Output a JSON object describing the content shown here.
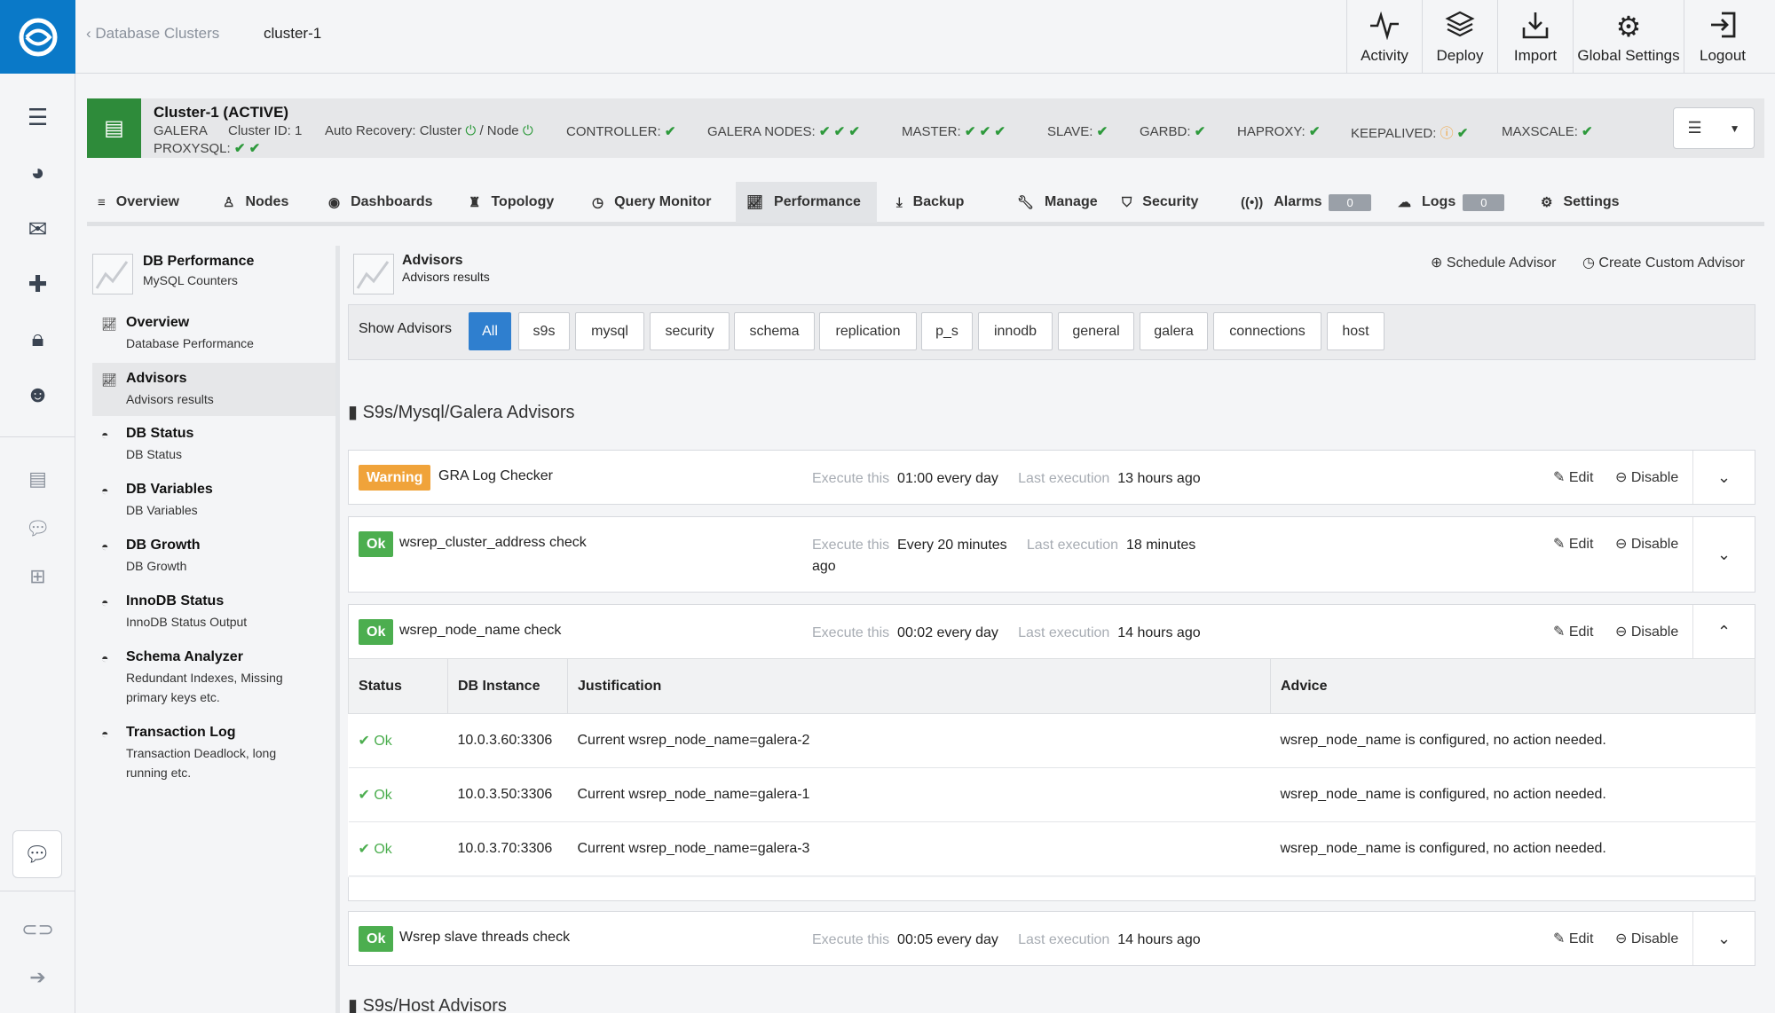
{
  "nav": {
    "back_label": "Database Clusters",
    "current_label": "cluster-1",
    "actions": [
      {
        "label": "Activity",
        "icon": "activity-icon"
      },
      {
        "label": "Deploy",
        "icon": "deploy-icon"
      },
      {
        "label": "Import",
        "icon": "import-icon"
      },
      {
        "label": "Global Settings",
        "icon": "gears-icon"
      },
      {
        "label": "Logout",
        "icon": "logout-icon"
      }
    ]
  },
  "cluster": {
    "title": "Cluster-1 (ACTIVE)",
    "type": "GALERA",
    "id_label": "Cluster ID: 1",
    "auto_recovery_label": "Auto Recovery: Cluster",
    "node_label": "/ Node",
    "controller_label": "CONTROLLER:",
    "galera_nodes_label": "GALERA NODES:",
    "master_label": "MASTER:",
    "slave_label": "SLAVE:",
    "garbd_label": "GARBD:",
    "haproxy_label": "HAPROXY:",
    "keepalived_label": "KEEPALIVED:",
    "maxscale_label": "MAXSCALE:",
    "proxysql_label": "PROXYSQL:",
    "status_colors": {
      "ok": "#2e9a3c",
      "warning": "#f0a33a"
    }
  },
  "tabs": [
    {
      "label": "Overview",
      "icon": "list-icon"
    },
    {
      "label": "Nodes",
      "icon": "sitemap-icon"
    },
    {
      "label": "Dashboards",
      "icon": "dashboard-icon"
    },
    {
      "label": "Topology",
      "icon": "topology-icon"
    },
    {
      "label": "Query Monitor",
      "icon": "query-icon"
    },
    {
      "label": "Performance",
      "icon": "chart-icon",
      "active": true
    },
    {
      "label": "Backup",
      "icon": "download-icon"
    },
    {
      "label": "Manage",
      "icon": "wrench-icon"
    },
    {
      "label": "Security",
      "icon": "shield-icon"
    },
    {
      "label": "Alarms",
      "icon": "radio-icon",
      "badge": "0"
    },
    {
      "label": "Logs",
      "icon": "cloud-icon",
      "badge": "0"
    },
    {
      "label": "Settings",
      "icon": "gear-icon"
    }
  ],
  "sidebar": {
    "header": {
      "title": "DB Performance",
      "subtitle": "MySQL Counters"
    },
    "items": [
      {
        "title": "Overview",
        "subtitle": "Database Performance"
      },
      {
        "title": "Advisors",
        "subtitle": "Advisors results"
      },
      {
        "title": "DB Status",
        "subtitle": "DB Status"
      },
      {
        "title": "DB Variables",
        "subtitle": "DB Variables"
      },
      {
        "title": "DB Growth",
        "subtitle": "DB Growth"
      },
      {
        "title": "InnoDB Status",
        "subtitle": "InnoDB Status Output"
      },
      {
        "title": "Schema Analyzer",
        "subtitle_line1": "Redundant Indexes, Missing",
        "subtitle_line2": "primary keys etc."
      },
      {
        "title": "Transaction Log",
        "subtitle_line1": "Transaction Deadlock, long",
        "subtitle_line2": "running etc."
      }
    ]
  },
  "main": {
    "title": "Advisors",
    "subtitle": "Advisors results",
    "schedule_label": "Schedule Advisor",
    "custom_label": "Create Custom Advisor",
    "filter_label": "Show Advisors",
    "filters": [
      "All",
      "s9s",
      "mysql",
      "security",
      "schema",
      "replication",
      "p_s",
      "innodb",
      "general",
      "galera",
      "connections",
      "host"
    ],
    "section1_title": "S9s/Mysql/Galera Advisors",
    "section2_title": "S9s/Host Advisors",
    "exec_label": "Execute this",
    "last_label": "Last execution",
    "edit_label": "Edit",
    "disable_label": "Disable",
    "advisors": [
      {
        "status": "Warning",
        "name": "GRA Log Checker",
        "schedule": "01:00 every day",
        "last": "13 hours ago"
      },
      {
        "status": "Ok",
        "name": "wsrep_cluster_address check",
        "schedule": "Every 20 minutes",
        "last": "18 minutes",
        "last_wrap": "ago"
      },
      {
        "status": "Ok",
        "name": "wsrep_node_name check",
        "schedule": "00:02 every day",
        "last": "14 hours ago"
      },
      {
        "status": "Ok",
        "name": "Wsrep slave threads check",
        "schedule": "00:05 every day",
        "last": "14 hours ago"
      }
    ],
    "results": {
      "columns": [
        "Status",
        "DB Instance",
        "Justification",
        "Advice"
      ],
      "rows": [
        {
          "status": "Ok",
          "instance": "10.0.3.60:3306",
          "justification": "Current wsrep_node_name=galera-2",
          "advice": "wsrep_node_name is configured, no action needed."
        },
        {
          "status": "Ok",
          "instance": "10.0.3.50:3306",
          "justification": "Current wsrep_node_name=galera-1",
          "advice": "wsrep_node_name is configured, no action needed."
        },
        {
          "status": "Ok",
          "instance": "10.0.3.70:3306",
          "justification": "Current wsrep_node_name=galera-3",
          "advice": "wsrep_node_name is configured, no action needed."
        }
      ]
    }
  }
}
